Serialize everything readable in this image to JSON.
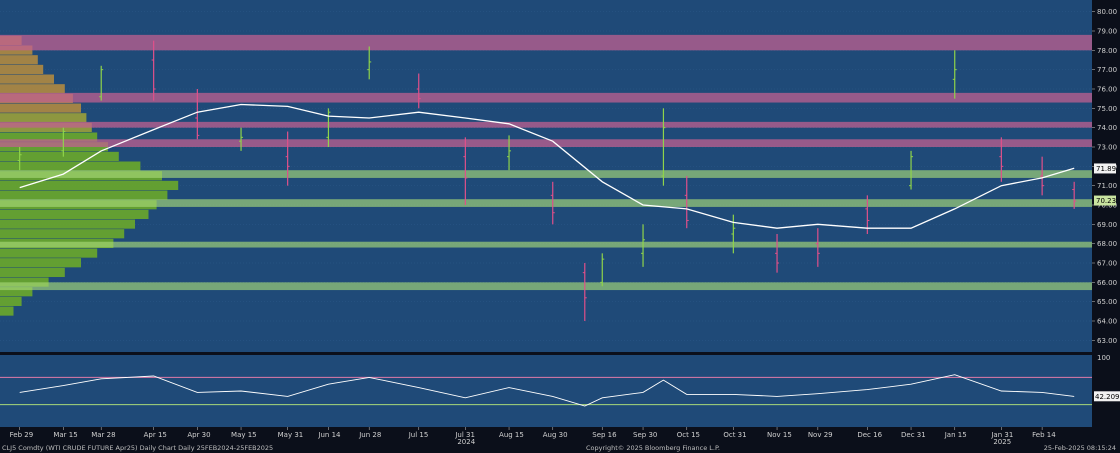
{
  "chart_data": [
    {
      "type": "line",
      "panel": "price",
      "security": "CLJ5 Comdty (WTI CRUDE FUTURE Apr25)",
      "ylim": [
        62.5,
        80.5
      ],
      "yticks": [
        "80.00",
        "79.00",
        "78.00",
        "77.00",
        "76.00",
        "75.00",
        "74.00",
        "73.00",
        "72.00",
        "71.00",
        "70.00",
        "69.00",
        "68.00",
        "67.00",
        "66.00",
        "65.00",
        "64.00",
        "63.00"
      ],
      "last_price_label": "70.23",
      "moving_average_label": "71.89",
      "colors": {
        "background": "#1f4a78",
        "up_bar": "#8fd44a",
        "down_bar": "#e0508a",
        "moving_average": "#ffffff",
        "resistance_band": "#c06090",
        "support_band": "#a8d878"
      },
      "resistance_bands": [
        [
          78.0,
          78.8
        ],
        [
          75.3,
          75.8
        ],
        [
          74.0,
          74.3
        ],
        [
          73.0,
          73.4
        ]
      ],
      "support_bands": [
        [
          71.4,
          71.8
        ],
        [
          69.9,
          70.3
        ],
        [
          67.8,
          68.1
        ],
        [
          65.6,
          66.0
        ]
      ],
      "volume_profile": [
        {
          "price": 78.5,
          "width": 0.08
        },
        {
          "price": 78.0,
          "width": 0.12
        },
        {
          "price": 77.5,
          "width": 0.14
        },
        {
          "price": 77.0,
          "width": 0.16
        },
        {
          "price": 76.5,
          "width": 0.2
        },
        {
          "price": 76.0,
          "width": 0.24
        },
        {
          "price": 75.5,
          "width": 0.27
        },
        {
          "price": 75.0,
          "width": 0.3
        },
        {
          "price": 74.5,
          "width": 0.32
        },
        {
          "price": 74.0,
          "width": 0.34
        },
        {
          "price": 73.5,
          "width": 0.36
        },
        {
          "price": 73.0,
          "width": 0.4
        },
        {
          "price": 72.5,
          "width": 0.44
        },
        {
          "price": 72.0,
          "width": 0.52
        },
        {
          "price": 71.5,
          "width": 0.6
        },
        {
          "price": 71.0,
          "width": 0.66
        },
        {
          "price": 70.5,
          "width": 0.62
        },
        {
          "price": 70.0,
          "width": 0.58
        },
        {
          "price": 69.5,
          "width": 0.55
        },
        {
          "price": 69.0,
          "width": 0.5
        },
        {
          "price": 68.5,
          "width": 0.46
        },
        {
          "price": 68.0,
          "width": 0.42
        },
        {
          "price": 67.5,
          "width": 0.36
        },
        {
          "price": 67.0,
          "width": 0.3
        },
        {
          "price": 66.5,
          "width": 0.24
        },
        {
          "price": 66.0,
          "width": 0.18
        },
        {
          "price": 65.5,
          "width": 0.12
        },
        {
          "price": 65.0,
          "width": 0.08
        },
        {
          "price": 64.5,
          "width": 0.05
        }
      ],
      "price_series": [
        {
          "date": "2024-02-29",
          "open": 72.3,
          "high": 73.0,
          "low": 71.8,
          "close": 72.6
        },
        {
          "date": "2024-03-15",
          "open": 72.8,
          "high": 74.0,
          "low": 72.5,
          "close": 73.8
        },
        {
          "date": "2024-03-28",
          "open": 75.6,
          "high": 77.2,
          "low": 75.4,
          "close": 77.0
        },
        {
          "date": "2024-04-15",
          "open": 77.5,
          "high": 78.5,
          "low": 75.4,
          "close": 76.0
        },
        {
          "date": "2024-04-30",
          "open": 74.5,
          "high": 76.0,
          "low": 73.4,
          "close": 73.6
        },
        {
          "date": "2024-05-15",
          "open": 73.3,
          "high": 74.0,
          "low": 72.8,
          "close": 73.5
        },
        {
          "date": "2024-05-31",
          "open": 72.5,
          "high": 73.8,
          "low": 71.0,
          "close": 72.0
        },
        {
          "date": "2024-06-14",
          "open": 73.5,
          "high": 75.0,
          "low": 73.0,
          "close": 74.8
        },
        {
          "date": "2024-06-28",
          "open": 77.0,
          "high": 78.2,
          "low": 76.5,
          "close": 77.4
        },
        {
          "date": "2024-07-15",
          "open": 76.0,
          "high": 76.8,
          "low": 75.0,
          "close": 75.5
        },
        {
          "date": "2024-07-31",
          "open": 72.5,
          "high": 73.5,
          "low": 70.0,
          "close": 71.4
        },
        {
          "date": "2024-08-15",
          "open": 72.5,
          "high": 73.6,
          "low": 71.8,
          "close": 72.8
        },
        {
          "date": "2024-08-30",
          "open": 70.5,
          "high": 71.2,
          "low": 69.0,
          "close": 69.6
        },
        {
          "date": "2024-09-10",
          "open": 66.5,
          "high": 67.0,
          "low": 64.0,
          "close": 65.2
        },
        {
          "date": "2024-09-16",
          "open": 66.0,
          "high": 67.5,
          "low": 65.8,
          "close": 67.2
        },
        {
          "date": "2024-09-30",
          "open": 67.5,
          "high": 69.0,
          "low": 66.8,
          "close": 68.2
        },
        {
          "date": "2024-10-07",
          "open": 71.5,
          "high": 75.0,
          "low": 71.0,
          "close": 74.0
        },
        {
          "date": "2024-10-15",
          "open": 70.5,
          "high": 71.5,
          "low": 68.8,
          "close": 69.2
        },
        {
          "date": "2024-10-31",
          "open": 68.5,
          "high": 69.5,
          "low": 67.5,
          "close": 68.8
        },
        {
          "date": "2024-11-15",
          "open": 67.5,
          "high": 68.5,
          "low": 66.5,
          "close": 67.0
        },
        {
          "date": "2024-11-29",
          "open": 68.0,
          "high": 68.8,
          "low": 66.8,
          "close": 67.5
        },
        {
          "date": "2024-12-16",
          "open": 69.8,
          "high": 70.5,
          "low": 68.5,
          "close": 69.2
        },
        {
          "date": "2024-12-31",
          "open": 71.0,
          "high": 72.8,
          "low": 70.8,
          "close": 72.5
        },
        {
          "date": "2025-01-15",
          "open": 76.5,
          "high": 78.0,
          "low": 75.5,
          "close": 77.0
        },
        {
          "date": "2025-01-31",
          "open": 72.5,
          "high": 73.5,
          "low": 71.2,
          "close": 72.0
        },
        {
          "date": "2025-02-14",
          "open": 71.5,
          "high": 72.5,
          "low": 70.5,
          "close": 71.0
        },
        {
          "date": "2025-02-25",
          "open": 70.8,
          "high": 71.2,
          "low": 69.8,
          "close": 70.2
        }
      ],
      "moving_average": [
        {
          "date": "2024-02-29",
          "value": 70.9
        },
        {
          "date": "2024-03-15",
          "value": 71.6
        },
        {
          "date": "2024-03-28",
          "value": 72.8
        },
        {
          "date": "2024-04-15",
          "value": 73.9
        },
        {
          "date": "2024-04-30",
          "value": 74.8
        },
        {
          "date": "2024-05-15",
          "value": 75.2
        },
        {
          "date": "2024-05-31",
          "value": 75.1
        },
        {
          "date": "2024-06-14",
          "value": 74.6
        },
        {
          "date": "2024-06-28",
          "value": 74.5
        },
        {
          "date": "2024-07-15",
          "value": 74.8
        },
        {
          "date": "2024-07-31",
          "value": 74.5
        },
        {
          "date": "2024-08-15",
          "value": 74.2
        },
        {
          "date": "2024-08-30",
          "value": 73.3
        },
        {
          "date": "2024-09-16",
          "value": 71.2
        },
        {
          "date": "2024-09-30",
          "value": 70.0
        },
        {
          "date": "2024-10-15",
          "value": 69.8
        },
        {
          "date": "2024-10-31",
          "value": 69.1
        },
        {
          "date": "2024-11-15",
          "value": 68.8
        },
        {
          "date": "2024-11-29",
          "value": 69.0
        },
        {
          "date": "2024-12-16",
          "value": 68.8
        },
        {
          "date": "2024-12-31",
          "value": 68.8
        },
        {
          "date": "2025-01-15",
          "value": 69.8
        },
        {
          "date": "2025-01-31",
          "value": 71.0
        },
        {
          "date": "2025-02-14",
          "value": 71.4
        },
        {
          "date": "2025-02-25",
          "value": 71.9
        }
      ]
    },
    {
      "type": "line",
      "panel": "oscillator",
      "ylim": [
        0,
        100
      ],
      "yticks": [
        "100"
      ],
      "last_value_label": "42.2099",
      "reference_levels": [
        70,
        30
      ],
      "colors": {
        "line": "#ffffff",
        "overbought": "#e07aa8",
        "oversold": "#a8d878",
        "background": "#1f4a78"
      },
      "series": [
        {
          "date": "2024-02-29",
          "value": 48
        },
        {
          "date": "2024-03-15",
          "value": 58
        },
        {
          "date": "2024-03-28",
          "value": 68
        },
        {
          "date": "2024-04-15",
          "value": 72
        },
        {
          "date": "2024-04-30",
          "value": 48
        },
        {
          "date": "2024-05-15",
          "value": 50
        },
        {
          "date": "2024-05-31",
          "value": 42
        },
        {
          "date": "2024-06-14",
          "value": 60
        },
        {
          "date": "2024-06-28",
          "value": 70
        },
        {
          "date": "2024-07-15",
          "value": 55
        },
        {
          "date": "2024-07-31",
          "value": 40
        },
        {
          "date": "2024-08-15",
          "value": 55
        },
        {
          "date": "2024-08-30",
          "value": 42
        },
        {
          "date": "2024-09-10",
          "value": 28
        },
        {
          "date": "2024-09-16",
          "value": 40
        },
        {
          "date": "2024-09-30",
          "value": 48
        },
        {
          "date": "2024-10-07",
          "value": 66
        },
        {
          "date": "2024-10-15",
          "value": 45
        },
        {
          "date": "2024-10-31",
          "value": 45
        },
        {
          "date": "2024-11-15",
          "value": 42
        },
        {
          "date": "2024-11-29",
          "value": 46
        },
        {
          "date": "2024-12-16",
          "value": 52
        },
        {
          "date": "2024-12-31",
          "value": 60
        },
        {
          "date": "2025-01-15",
          "value": 74
        },
        {
          "date": "2025-01-31",
          "value": 50
        },
        {
          "date": "2025-02-14",
          "value": 48
        },
        {
          "date": "2025-02-25",
          "value": 42
        }
      ]
    }
  ],
  "x_axis": {
    "labels": [
      {
        "date": "2024-02-29",
        "text": "Feb 29"
      },
      {
        "date": "2024-03-15",
        "text": "Mar 15"
      },
      {
        "date": "2024-03-28",
        "text": "Mar 28"
      },
      {
        "date": "2024-04-15",
        "text": "Apr 15"
      },
      {
        "date": "2024-04-30",
        "text": "Apr 30"
      },
      {
        "date": "2024-05-15",
        "text": "May 15"
      },
      {
        "date": "2024-05-31",
        "text": "May 31"
      },
      {
        "date": "2024-06-14",
        "text": "Jun 14"
      },
      {
        "date": "2024-06-28",
        "text": "Jun 28"
      },
      {
        "date": "2024-07-15",
        "text": "Jul 15"
      },
      {
        "date": "2024-07-31",
        "text": "Jul 31"
      },
      {
        "date": "2024-08-15",
        "text": "Aug 15"
      },
      {
        "date": "2024-08-30",
        "text": "Aug 30"
      },
      {
        "date": "2024-09-16",
        "text": "Sep 16"
      },
      {
        "date": "2024-09-30",
        "text": "Sep 30"
      },
      {
        "date": "2024-10-15",
        "text": "Oct 15"
      },
      {
        "date": "2024-10-31",
        "text": "Oct 31"
      },
      {
        "date": "2024-11-15",
        "text": "Nov 15"
      },
      {
        "date": "2024-11-29",
        "text": "Nov 29"
      },
      {
        "date": "2024-12-16",
        "text": "Dec 16"
      },
      {
        "date": "2024-12-31",
        "text": "Dec 31"
      },
      {
        "date": "2025-01-15",
        "text": "Jan 15"
      },
      {
        "date": "2025-01-31",
        "text": "Jan 31"
      },
      {
        "date": "2025-02-14",
        "text": "Feb 14"
      }
    ],
    "year_labels": [
      {
        "date": "2024-07-31",
        "text": "2024"
      },
      {
        "date": "2025-01-31",
        "text": "2025"
      }
    ]
  },
  "footer": {
    "left": "CLJ5 Comdty (WTI CRUDE FUTURE Apr25) Daily Chart Daily 25FEB2024-25FEB2025",
    "center": "Copyright© 2025 Bloomberg Finance L.P.",
    "right": "25-Feb-2025 08:15:24"
  }
}
